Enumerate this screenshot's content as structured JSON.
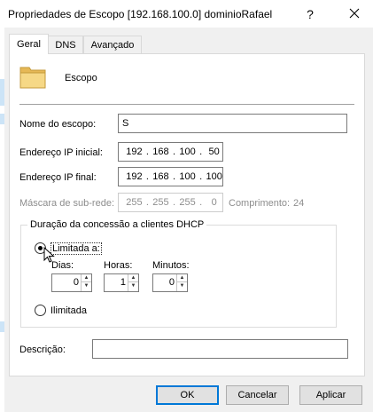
{
  "window": {
    "title": "Propriedades de Escopo [192.168.100.0] dominioRafael",
    "help_label": "?",
    "close_label": "✕"
  },
  "tabs": [
    {
      "label": "Geral",
      "selected": true
    },
    {
      "label": "DNS",
      "selected": false
    },
    {
      "label": "Avançado",
      "selected": false
    }
  ],
  "scope": {
    "icon": "folder-icon",
    "label": "Escopo"
  },
  "fields": {
    "scope_name_label": "Nome do escopo:",
    "scope_name_value": "S",
    "start_ip_label": "Endereço IP inicial:",
    "start_ip": [
      "192",
      "168",
      "100",
      "50"
    ],
    "end_ip_label": "Endereço IP final:",
    "end_ip": [
      "192",
      "168",
      "100",
      "100"
    ],
    "subnet_label": "Máscara de sub-rede:",
    "subnet": [
      "255",
      "255",
      "255",
      "0"
    ],
    "length_label": "Comprimento:",
    "length_value": "24"
  },
  "lease": {
    "group_title": "Duração da concessão a clientes DHCP",
    "limited_label": "Limitada a:",
    "limited_selected": true,
    "days_label": "Dias:",
    "days_value": "0",
    "hours_label": "Horas:",
    "hours_value": "1",
    "minutes_label": "Minutos:",
    "minutes_value": "0",
    "unlimited_label": "Ilimitada",
    "unlimited_selected": false
  },
  "description": {
    "label": "Descrição:",
    "value": ""
  },
  "buttons": {
    "ok": "OK",
    "cancel": "Cancelar",
    "apply": "Aplicar"
  },
  "colors": {
    "accent": "#0078d7",
    "window_bg": "#f0f0f0",
    "panel_bg": "#ffffff"
  }
}
